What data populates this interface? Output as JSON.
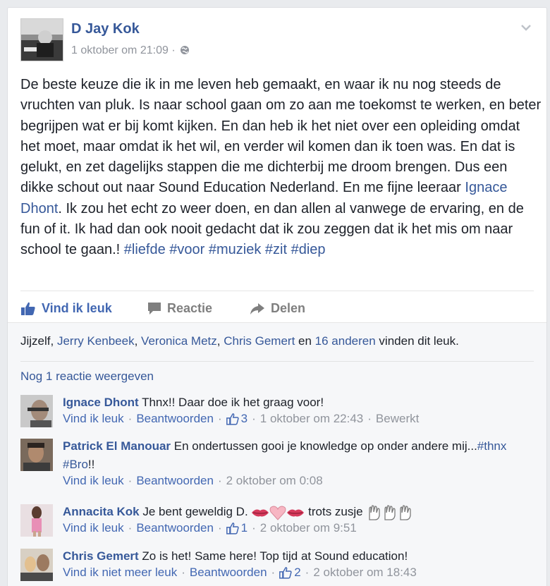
{
  "post": {
    "author": "D Jay Kok",
    "timestamp": "1 oktober om 21:09",
    "meta_sep": "·",
    "body_pre": "De beste keuze die ik in me leven heb gemaakt, en waar ik nu nog steeds de vruchten van pluk. Is naar school gaan om zo aan me toekomst te werken, en beter begrijpen wat er bij komt kijken. En dan heb ik het niet over een opleiding omdat het moet, maar omdat ik het wil, en verder wil komen dan ik toen was. En dat is gelukt, en zet dagelijks stappen die me dichterbij me droom brengen. Dus een dikke schout out naar Sound Education Nederland. En me fijne leeraar ",
    "body_mention": "Ignace Dhont",
    "body_post": ". Ik zou het echt zo weer doen, en dan allen al vanwege de ervaring, en de fun of it. Ik had dan ook nooit gedacht dat ik zou zeggen dat ik het mis om naar school te gaan.! ",
    "hashtags": [
      "#liefde",
      "#voor",
      "#muziek",
      "#zit",
      "#diep"
    ]
  },
  "actions": {
    "like": "Vind ik leuk",
    "comment": "Reactie",
    "share": "Delen"
  },
  "likes": {
    "self": "Jijzelf",
    "sep1": ", ",
    "name1": "Jerry Kenbeek",
    "sep2": ", ",
    "name2": "Veronica Metz",
    "sep3": ", ",
    "name3": "Chris Gemert",
    "and": " en ",
    "others": "16 anderen",
    "suffix": " vinden dit leuk."
  },
  "more_comments": "Nog 1 reactie weergeven",
  "comments": [
    {
      "name": "Ignace Dhont",
      "text": " Thnx!! Daar doe ik het graag voor!",
      "like_link": "Vind ik leuk",
      "reply": "Beantwoorden",
      "likes": "3",
      "time": "1 oktober om 22:43",
      "edited": "Bewerkt"
    },
    {
      "name": "Patrick El Manouar",
      "text_pre": " En ondertussen gooi je knowledge op onder andere mij...",
      "tag1": "#thnx",
      "tag2": "#Bro",
      "text_post": "!!",
      "like_link": "Vind ik leuk",
      "reply": "Beantwoorden",
      "time": "2 oktober om 0:08"
    },
    {
      "name": "Annacita Kok",
      "text_pre": " Je bent geweldig D. ",
      "text_post": " trots zusje ",
      "like_link": "Vind ik leuk",
      "reply": "Beantwoorden",
      "likes": "1",
      "time": "2 oktober om 9:51"
    },
    {
      "name": "Chris Gemert",
      "text": " Zo is het! Same here! Top tijd at Sound education!",
      "like_link": "Vind ik niet meer leuk",
      "reply": "Beantwoorden",
      "likes": "2",
      "time": "2 oktober om 18:43"
    }
  ],
  "icons": {
    "globe": "globe-icon",
    "chevron": "chevron-down-icon",
    "like": "thumbs-up-icon",
    "comment": "comment-icon",
    "share": "share-arrow-icon"
  },
  "colors": {
    "link": "#365899",
    "action_blue": "#4267b2",
    "meta_gray": "#90949c"
  }
}
